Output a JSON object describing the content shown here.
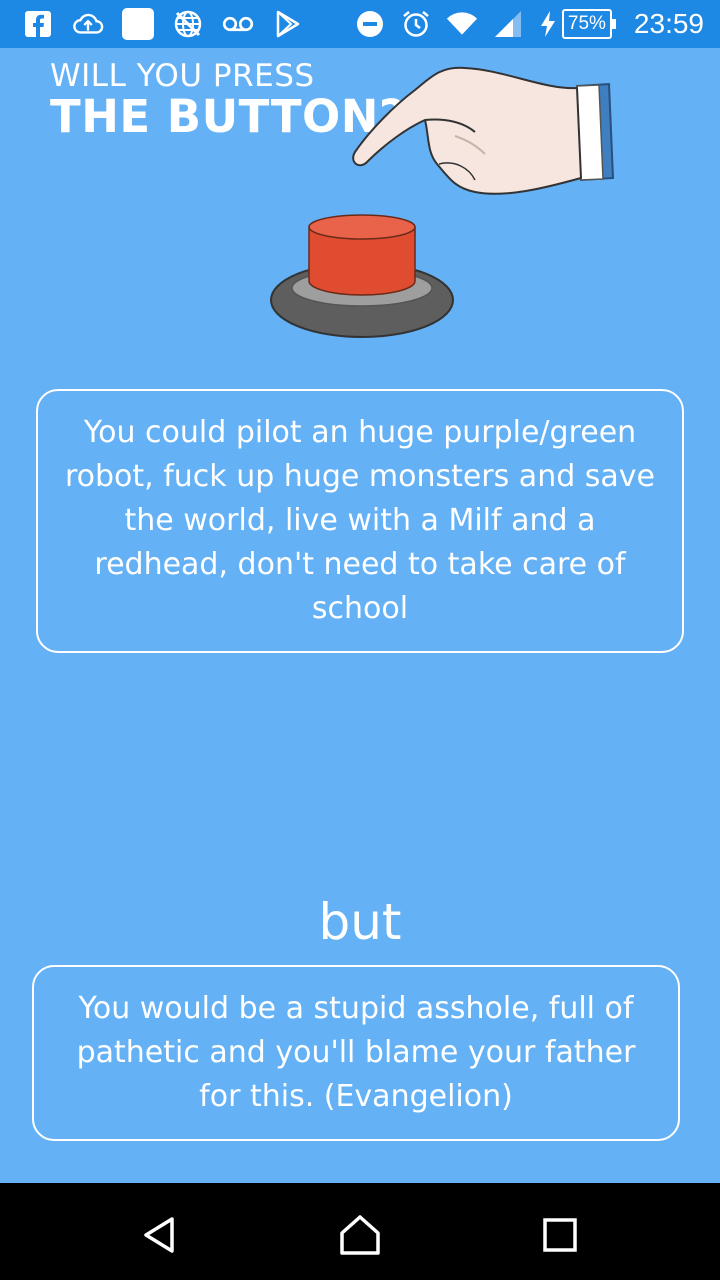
{
  "status_bar": {
    "battery_percent": "75%",
    "time": "23:59",
    "icons": [
      "facebook-icon",
      "cloud-upload-icon",
      "white-square-icon",
      "no-network-globe-icon",
      "voicemail-icon",
      "play-store-icon",
      "do-not-disturb-icon",
      "alarm-icon",
      "wifi-icon",
      "signal-icon",
      "charging-icon",
      "battery-icon"
    ]
  },
  "header": {
    "line1": "WILL YOU PRESS",
    "line2": "THE BUTTON?"
  },
  "colors": {
    "background": "#64b1f6",
    "status_bar": "#1e88e5",
    "button_red": "#e04c2f",
    "button_base": "#5e5e5e"
  },
  "main": {
    "benefit_text": "You could pilot an huge purple/green robot, fuck up huge monsters and save the world, live with a Milf and a redhead, don't need to take care of school",
    "connector": "but",
    "drawback_text": "You would be a stupid asshole, full of pathetic and you'll blame your father for this. (Evangelion)"
  },
  "nav_bar": {
    "icons": [
      "back-icon",
      "home-icon",
      "recents-icon"
    ]
  }
}
